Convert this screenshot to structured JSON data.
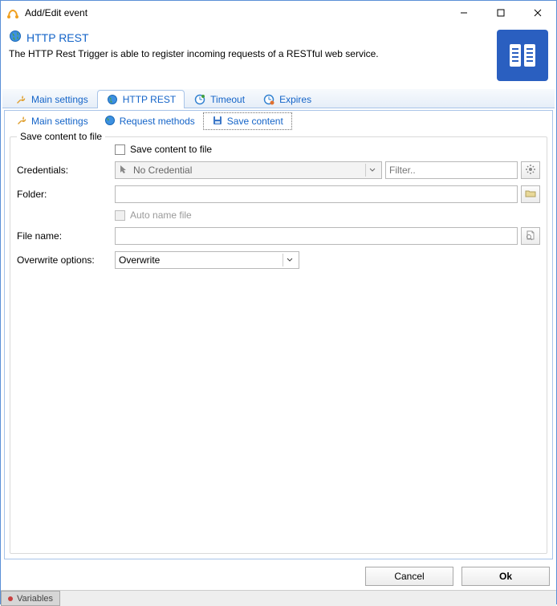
{
  "window": {
    "title": "Add/Edit event"
  },
  "header": {
    "title": "HTTP REST",
    "description": "The HTTP Rest Trigger is able to register incoming requests of a RESTful web service."
  },
  "tabs_outer": {
    "items": [
      {
        "label": "Main settings"
      },
      {
        "label": "HTTP REST"
      },
      {
        "label": "Timeout"
      },
      {
        "label": "Expires"
      }
    ],
    "active_index": 1
  },
  "tabs_inner": {
    "items": [
      {
        "label": "Main settings"
      },
      {
        "label": "Request methods"
      },
      {
        "label": "Save content"
      }
    ],
    "active_index": 2
  },
  "fieldset": {
    "legend": "Save content to file",
    "save_checkbox_label": "Save content to file",
    "credentials": {
      "label": "Credentials:",
      "selected": "No Credential",
      "filter_placeholder": "Filter.."
    },
    "folder": {
      "label": "Folder:",
      "value": ""
    },
    "autoname": {
      "label": "Auto name file"
    },
    "filename": {
      "label": "File name:",
      "value": ""
    },
    "overwrite": {
      "label": "Overwrite options:",
      "selected": "Overwrite"
    }
  },
  "buttons": {
    "cancel": "Cancel",
    "ok": "Ok"
  },
  "statusbar": {
    "variables": "Variables"
  }
}
